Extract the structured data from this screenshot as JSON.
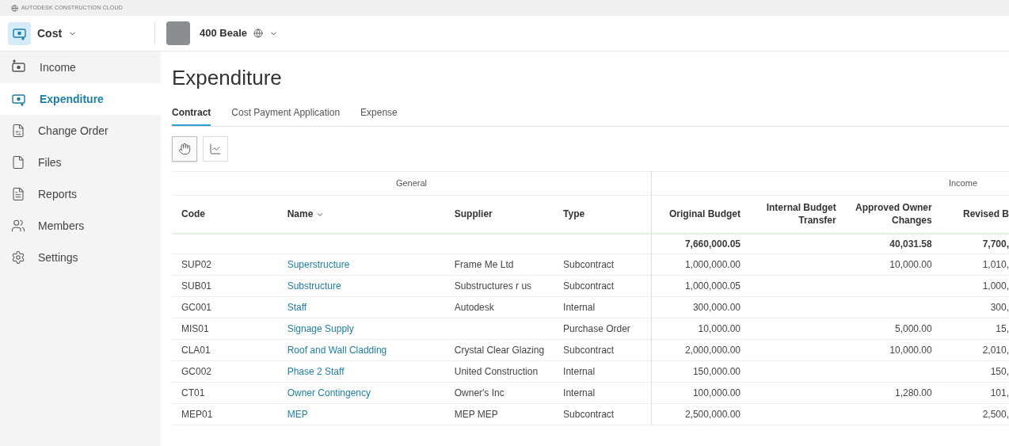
{
  "brand": "AUTODESK CONSTRUCTION CLOUD",
  "module": {
    "label": "Cost"
  },
  "project": {
    "name": "400 Beale"
  },
  "sidebar": {
    "items": [
      {
        "label": "Income",
        "selected": false
      },
      {
        "label": "Expenditure",
        "selected": true
      },
      {
        "label": "Change Order",
        "selected": false
      },
      {
        "label": "Files",
        "selected": false
      },
      {
        "label": "Reports",
        "selected": false
      },
      {
        "label": "Members",
        "selected": false
      },
      {
        "label": "Settings",
        "selected": false
      }
    ]
  },
  "page_title": "Expenditure",
  "tabs": [
    {
      "label": "Contract",
      "selected": true
    },
    {
      "label": "Cost Payment Application",
      "selected": false
    },
    {
      "label": "Expense",
      "selected": false
    }
  ],
  "toolbar": [
    {
      "selected": true
    },
    {
      "selected": false
    }
  ],
  "table": {
    "groups": [
      "General",
      "Income"
    ],
    "columns": [
      {
        "label": "Code",
        "sorted": false
      },
      {
        "label": "Name",
        "sorted": true
      },
      {
        "label": "Supplier",
        "sorted": false
      },
      {
        "label": "Type",
        "sorted": false
      },
      {
        "label": "Original Budget",
        "sorted": false
      },
      {
        "label": "Internal Budget Transfer",
        "sorted": false
      },
      {
        "label": "Approved Owner Changes",
        "sorted": false
      },
      {
        "label": "Revised B",
        "sorted": false
      }
    ],
    "totals": {
      "original_budget": "7,660,000.05",
      "approved_owner_changes": "40,031.58",
      "revised_b": "7,700,"
    },
    "rows": [
      {
        "code": "SUP02",
        "name": "Superstructure",
        "supplier": "Frame Me Ltd",
        "type": "Subcontract",
        "original_budget": "1,000,000.00",
        "approved_owner_changes": "10,000.00",
        "revised_b": "1,010,"
      },
      {
        "code": "SUB01",
        "name": "Substructure",
        "supplier": "Substructures r us",
        "type": "Subcontract",
        "original_budget": "1,000,000.05",
        "revised_b": "1,000,"
      },
      {
        "code": "GC001",
        "name": "Staff",
        "supplier": "Autodesk",
        "type": "Internal",
        "original_budget": "300,000.00",
        "revised_b": "300,"
      },
      {
        "code": "MIS01",
        "name": "Signage Supply",
        "type": "Purchase Order",
        "original_budget": "10,000.00",
        "approved_owner_changes": "5,000.00",
        "revised_b": "15,"
      },
      {
        "code": "CLA01",
        "name": "Roof and Wall Cladding",
        "supplier": "Crystal Clear Glazing",
        "type": "Subcontract",
        "original_budget": "2,000,000.00",
        "approved_owner_changes": "10,000.00",
        "revised_b": "2,010,"
      },
      {
        "code": "GC002",
        "name": "Phase 2 Staff",
        "supplier": "United Construction",
        "type": "Internal",
        "original_budget": "150,000.00",
        "revised_b": "150,"
      },
      {
        "code": "CT01",
        "name": "Owner Contingency",
        "supplier": "Owner's Inc",
        "type": "Internal",
        "original_budget": "100,000.00",
        "approved_owner_changes": "1,280.00",
        "revised_b": "101,"
      },
      {
        "code": "MEP01",
        "name": "MEP",
        "supplier": "MEP MEP",
        "type": "Subcontract",
        "original_budget": "2,500,000.00",
        "revised_b": "2,500,"
      }
    ]
  }
}
